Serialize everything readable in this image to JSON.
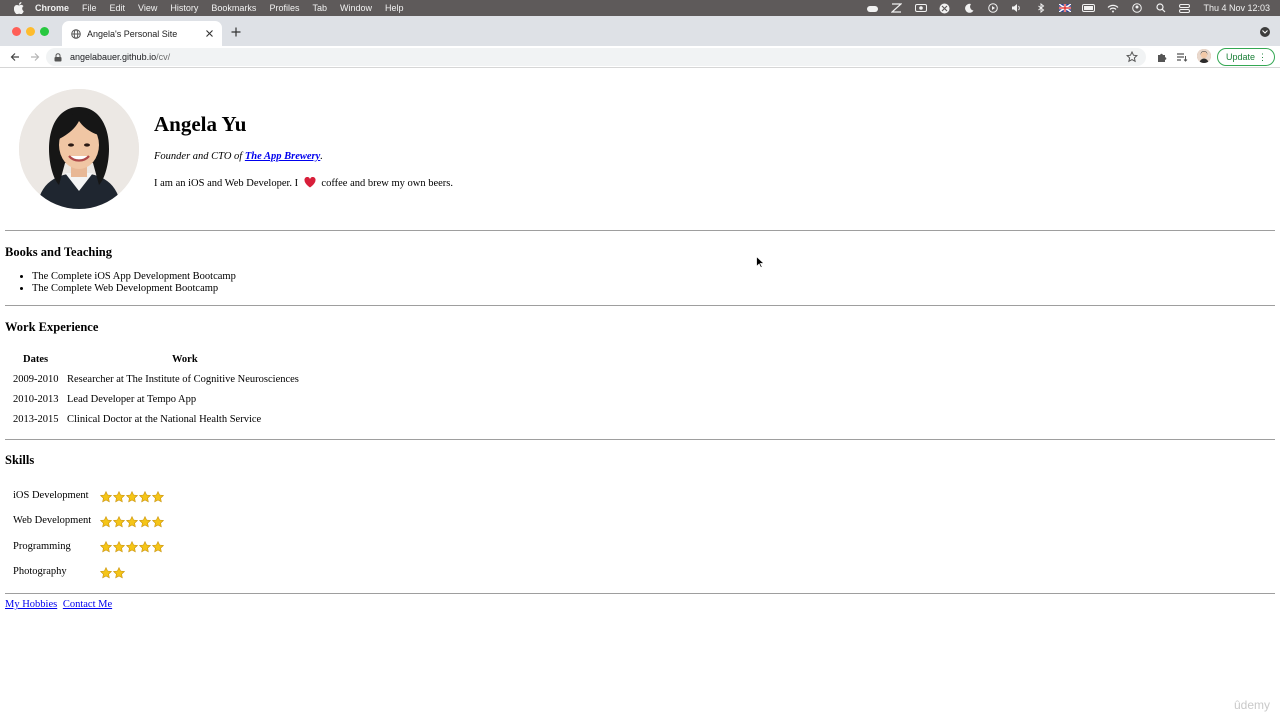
{
  "menubar": {
    "items": [
      "Chrome",
      "File",
      "Edit",
      "View",
      "History",
      "Bookmarks",
      "Profiles",
      "Tab",
      "Window",
      "Help"
    ],
    "clock": "Thu 4 Nov  12:03"
  },
  "browser": {
    "tab_title": "Angela's Personal Site",
    "url_host": "angelabauer.github.io",
    "url_path": "/cv/",
    "update_label": "Update"
  },
  "profile": {
    "name": "Angela Yu",
    "tagline_prefix": "Founder and CTO of ",
    "company": "The App Brewery",
    "tagline_suffix": ".",
    "bio_before": "I am an iOS and Web Developer. I",
    "bio_after": "coffee and brew my own beers."
  },
  "books": {
    "heading": "Books and Teaching",
    "items": [
      "The Complete iOS App Development Bootcamp",
      "The Complete Web Development Bootcamp"
    ]
  },
  "work": {
    "heading": "Work Experience",
    "columns": [
      "Dates",
      "Work"
    ],
    "rows": [
      {
        "dates": "2009-2010",
        "work": "Researcher at The Institute of Cognitive Neurosciences"
      },
      {
        "dates": "2010-2013",
        "work": "Lead Developer at Tempo App"
      },
      {
        "dates": "2013-2015",
        "work": "Clinical Doctor at the National Health Service"
      }
    ]
  },
  "skills": {
    "heading": "Skills",
    "items": [
      {
        "name": "iOS Development",
        "stars": 5
      },
      {
        "name": "Web Development",
        "stars": 5
      },
      {
        "name": "Programming",
        "stars": 5
      },
      {
        "name": "Photography",
        "stars": 2
      }
    ]
  },
  "footer_links": [
    "My Hobbies",
    "Contact Me"
  ],
  "watermark": "ûdemy",
  "colors": {
    "link": "#0000ee",
    "star_fill": "#f5c518",
    "heart": "#d81e3a",
    "update_green": "#1a7f37"
  },
  "icons": [
    "apple-icon",
    "wifi-icon",
    "battery-icon",
    "search-icon",
    "globe-icon",
    "close-icon",
    "plus-icon",
    "back-icon",
    "forward-icon",
    "reload-icon",
    "lock-icon",
    "star-icon",
    "extensions-icon",
    "reading-list-icon",
    "heart-icon",
    "skill-star-icon"
  ]
}
